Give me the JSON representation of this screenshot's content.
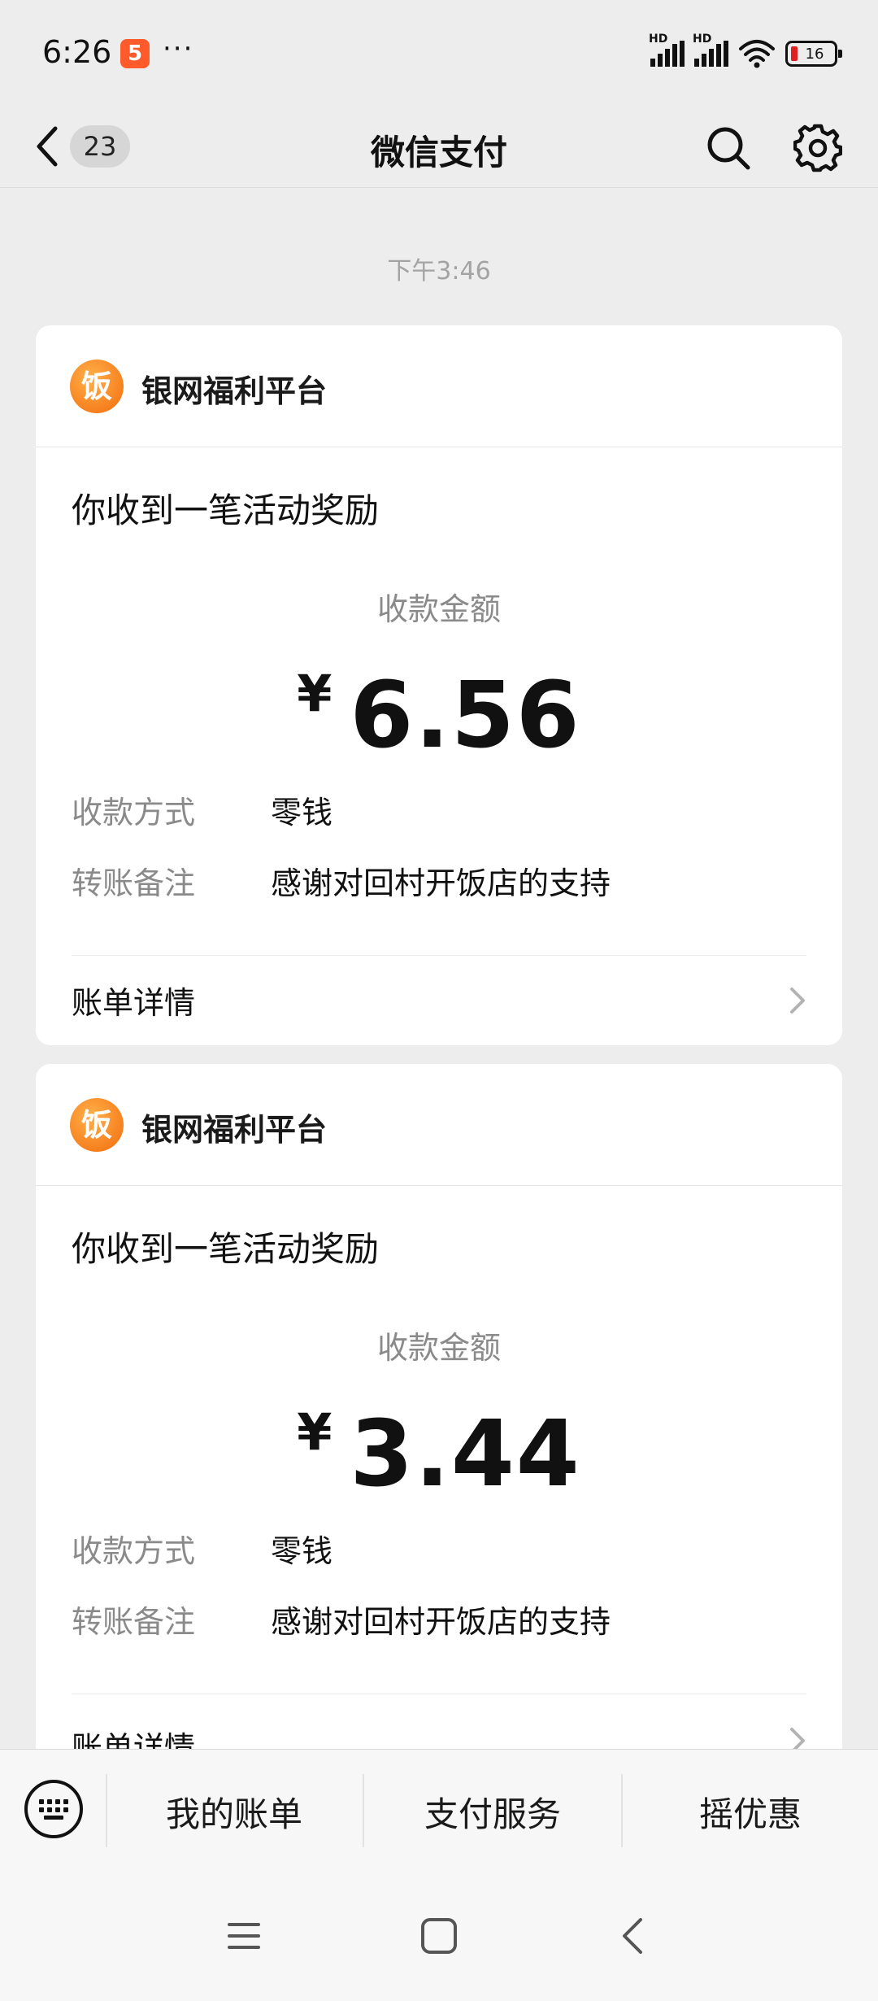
{
  "status_bar": {
    "time": "6:26",
    "app_icon_label": "5",
    "more": "···",
    "signal_1_label": "HD",
    "signal_2_label": "HD",
    "battery": "16"
  },
  "nav": {
    "unread_count": "23",
    "title": "微信支付"
  },
  "timestamp": "下午3:46",
  "messages": [
    {
      "merchant_name": "银网福利平台",
      "merchant_logo_char": "饭",
      "title": "你收到一笔活动奖励",
      "amount_label": "收款金额",
      "currency": "¥",
      "amount": "6.56",
      "method_label": "收款方式",
      "method_value": "零钱",
      "note_label": "转账备注",
      "note_value": "感谢对回村开饭店的支持",
      "detail_label": "账单详情"
    },
    {
      "merchant_name": "银网福利平台",
      "merchant_logo_char": "饭",
      "title": "你收到一笔活动奖励",
      "amount_label": "收款金额",
      "currency": "¥",
      "amount": "3.44",
      "method_label": "收款方式",
      "method_value": "零钱",
      "note_label": "转账备注",
      "note_value": "感谢对回村开饭店的支持",
      "detail_label": "账单详情"
    }
  ],
  "bottom_menu": {
    "items": [
      "我的账单",
      "支付服务",
      "摇优惠"
    ]
  },
  "colors": {
    "background": "#ededed",
    "card": "#ffffff",
    "merchant_logo": "#f36b0c",
    "muted_text": "#8a8a8a"
  },
  "icons": {
    "back": "back-arrow-icon",
    "search": "search-icon",
    "settings": "gear-icon",
    "keyboard": "keyboard-icon",
    "chevron": "chevron-right-icon"
  }
}
